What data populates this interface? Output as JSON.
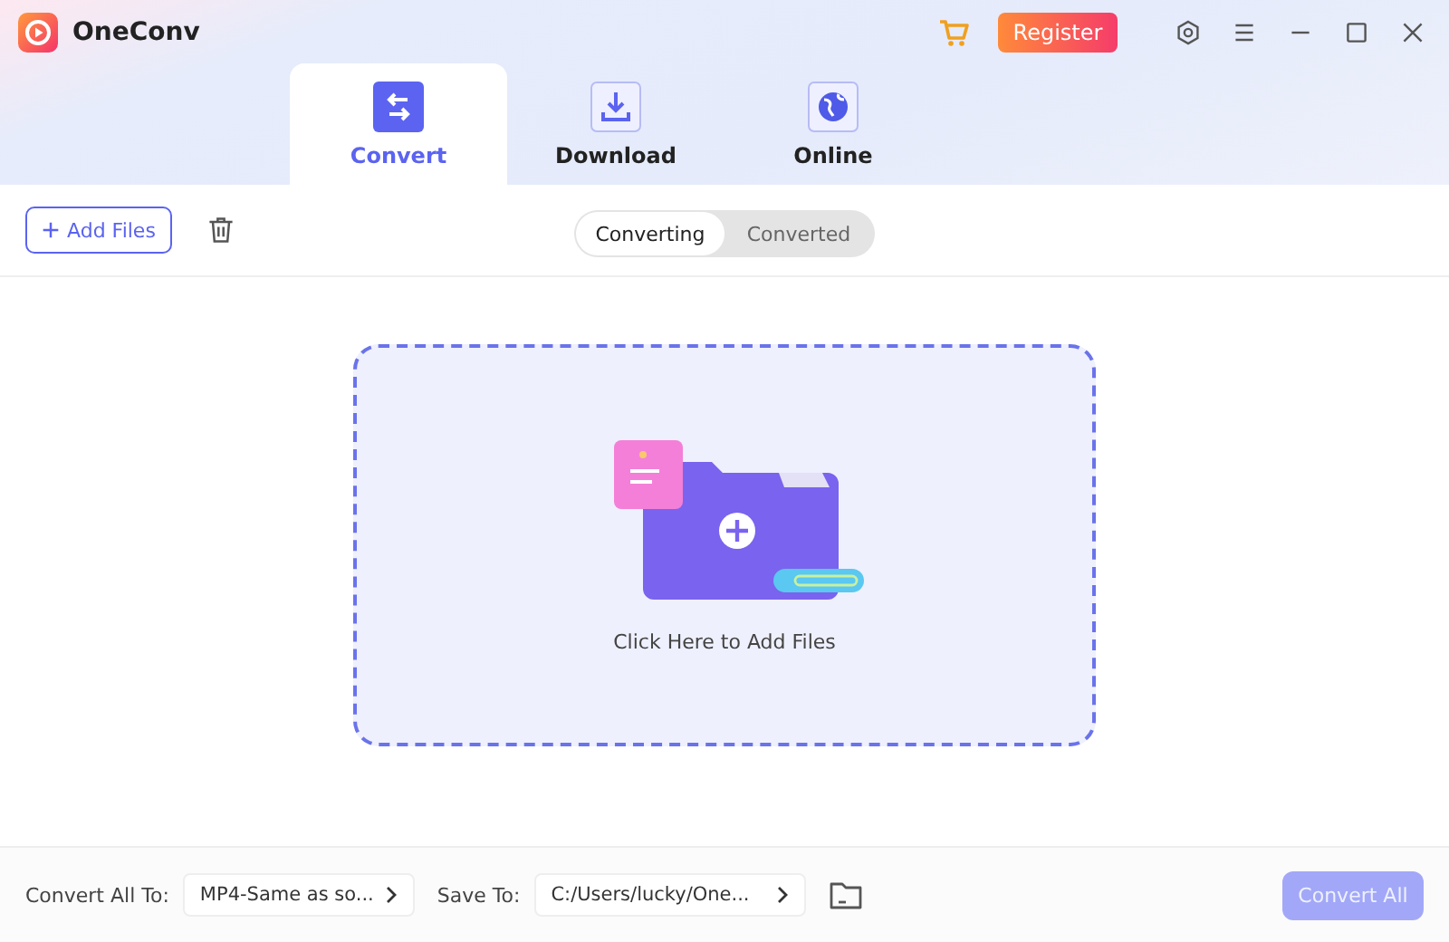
{
  "app": {
    "title": "OneConv"
  },
  "register_button": "Register",
  "tabs": [
    {
      "label": "Convert",
      "selected": true,
      "kind": "convert"
    },
    {
      "label": "Download",
      "selected": false,
      "kind": "download"
    },
    {
      "label": "Online",
      "selected": false,
      "kind": "online"
    }
  ],
  "toolbar": {
    "add_button": "Add Files",
    "segments": [
      {
        "label": "Converting",
        "selected": true
      },
      {
        "label": "Converted",
        "selected": false
      }
    ]
  },
  "drop_zone": {
    "label": "Click Here to Add Files"
  },
  "footer": {
    "format_label": "Convert All To:",
    "format_value": "MP4-Same as so...",
    "save_label": "Save To:",
    "save_value": "C:/Users/lucky/One...",
    "convert_button": {
      "label": "Convert All",
      "disabled": true
    }
  }
}
